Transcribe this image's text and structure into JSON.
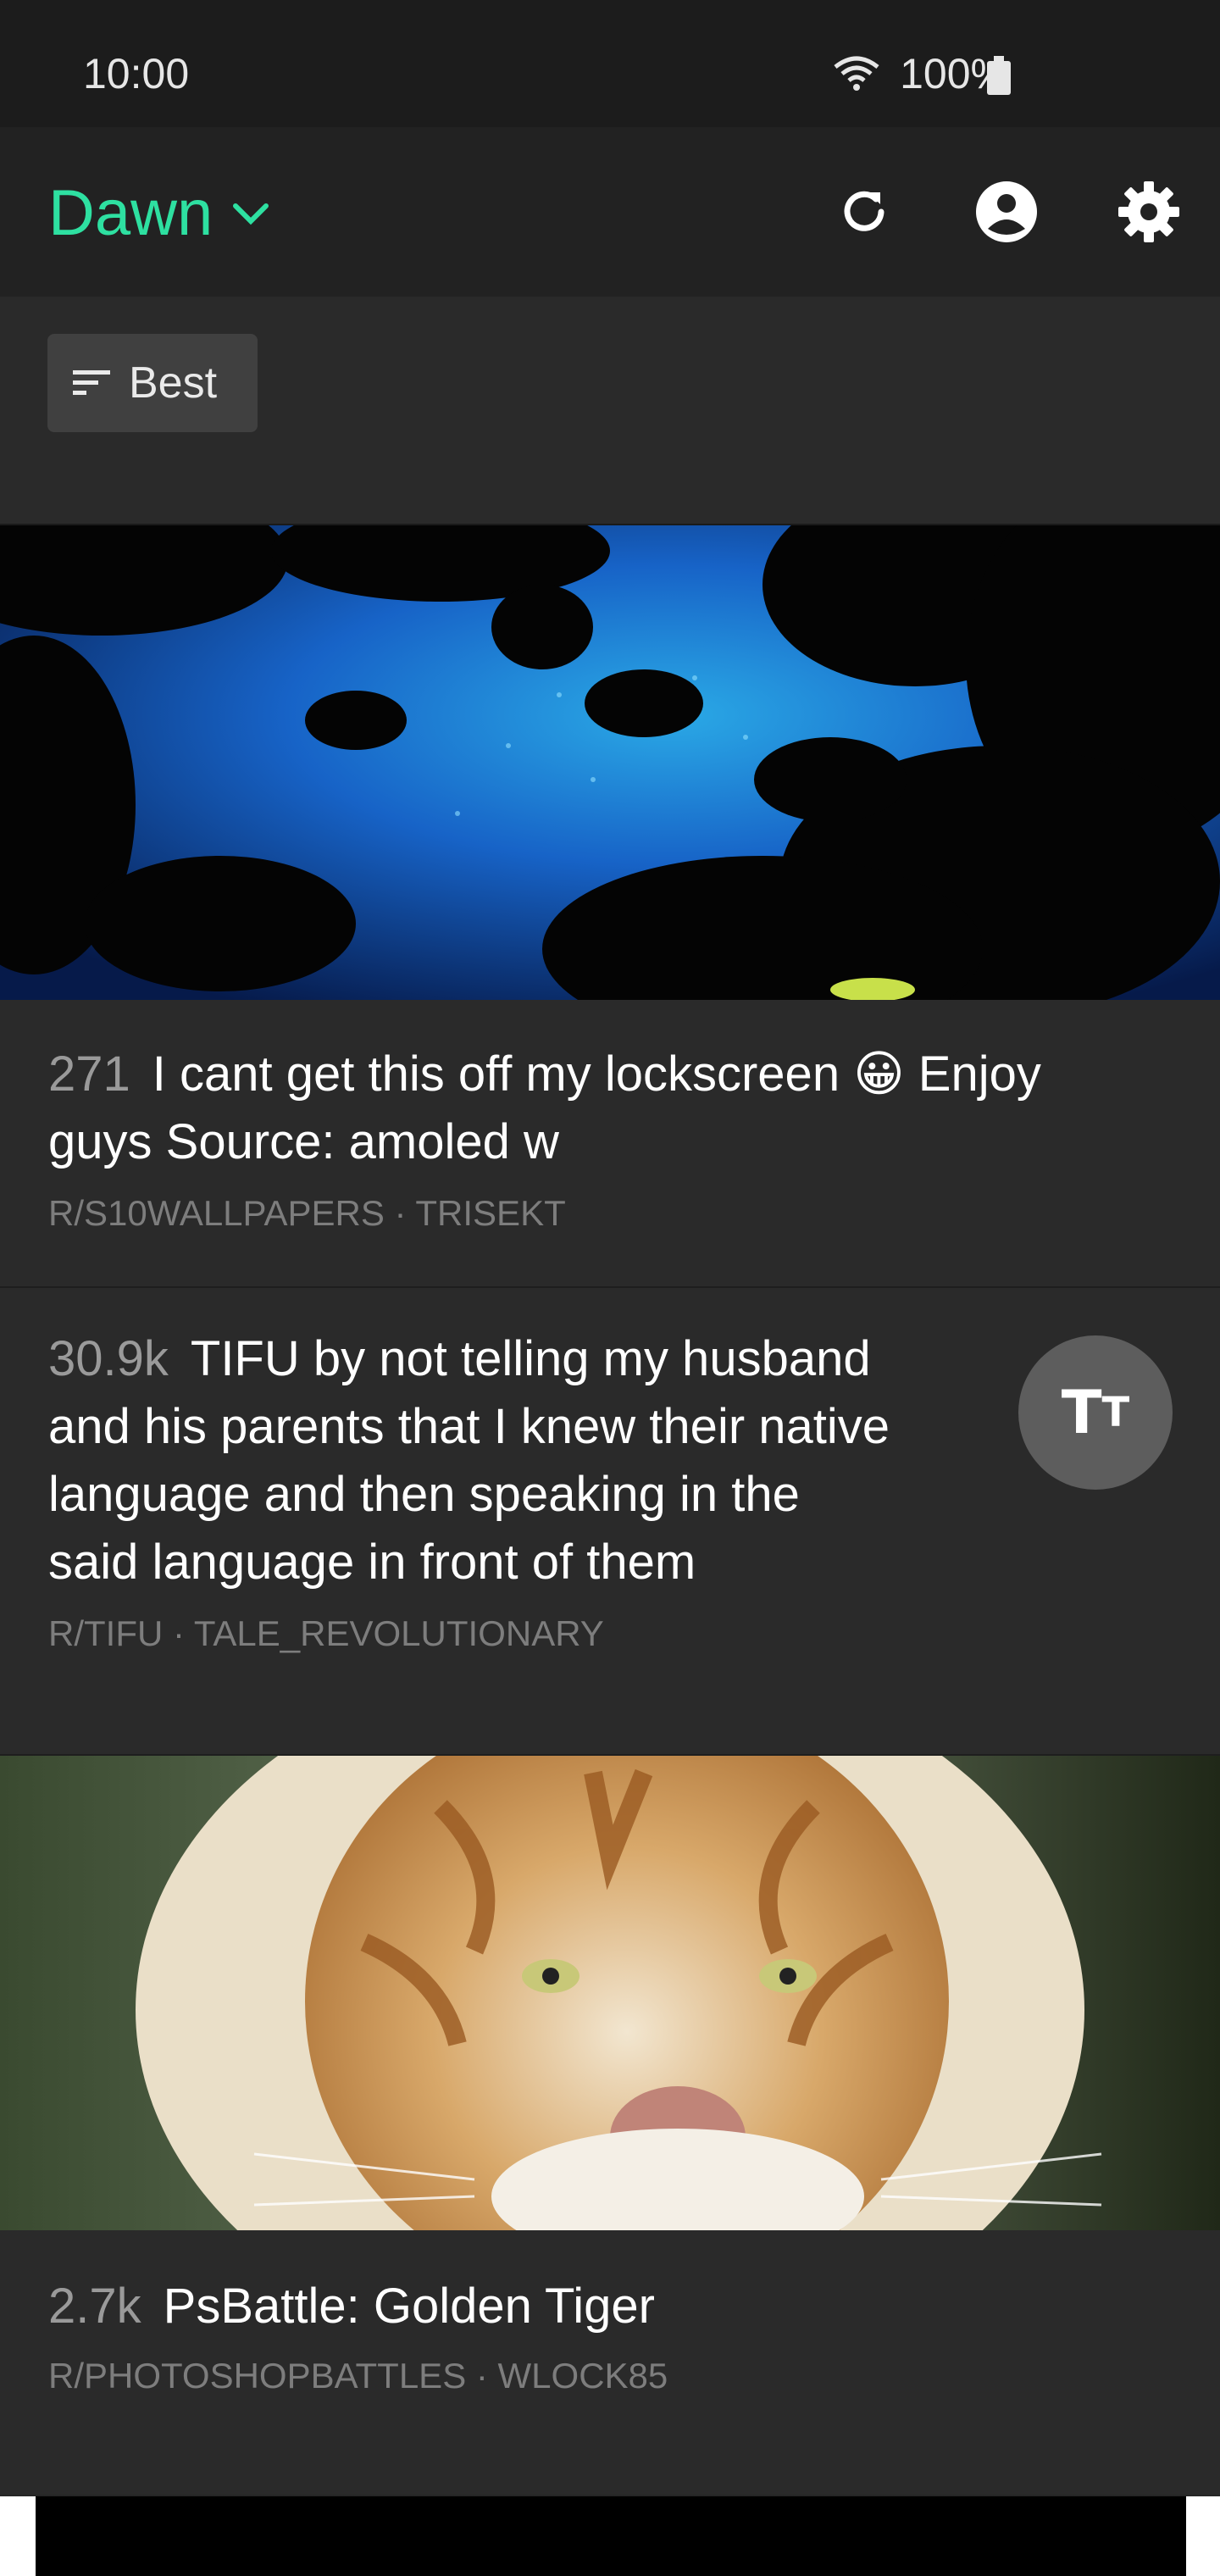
{
  "status": {
    "time": "10:00",
    "battery": "100%"
  },
  "app": {
    "title": "Dawn"
  },
  "icons": {
    "refresh": "refresh-icon",
    "account": "account-icon",
    "settings": "gear-icon",
    "sort": "sort-icon",
    "fab": "text-size-icon"
  },
  "colors": {
    "accent": "#2ee0a1",
    "background": "#262626",
    "appbar": "#222222"
  },
  "sort": {
    "label": "Best"
  },
  "posts": [
    {
      "score": "271",
      "title": "I cant get this off my lockscreen 😀 Enjoy guys Source: amoled w",
      "title_line1": "I cant get this off my lockscreen 😀 Enjoy",
      "title_line2": "guys Source: amoled w",
      "meta": "R/S10WALLPAPERS · TRISEKT"
    },
    {
      "score": "30.9k",
      "title": "TIFU by not telling my husband and his parents that I knew their native language and then speaking in the said language in front of them",
      "title_line1": "TIFU by not telling my husband",
      "title_line2": "and his parents that I knew their native",
      "title_line3": "language and then speaking in the",
      "title_line4": "said language in front of them",
      "meta": "R/TIFU · TALE_REVOLUTIONARY"
    },
    {
      "score": "2.7k",
      "title": "PsBattle: Golden Tiger",
      "meta": "R/PHOTOSHOPBATTLES · WLOCK85"
    }
  ],
  "fab": {
    "big": "T",
    "small": "T"
  }
}
